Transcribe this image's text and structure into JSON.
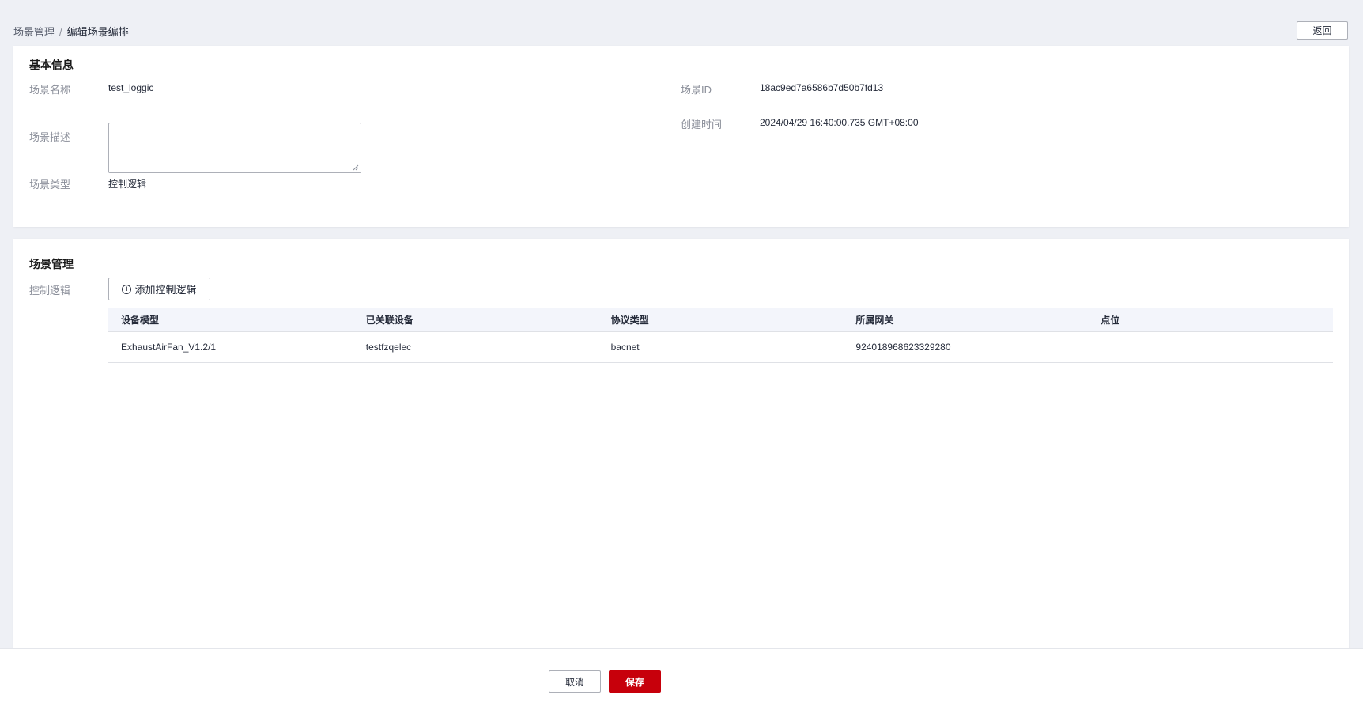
{
  "breadcrumb": {
    "parent": "场景管理",
    "separator": "/",
    "current": "编辑场景编排"
  },
  "back_button": "返回",
  "basic_info": {
    "title": "基本信息",
    "scene_name_label": "场景名称",
    "scene_name_value": "test_loggic",
    "scene_desc_label": "场景描述",
    "scene_desc_value": "",
    "scene_type_label": "场景类型",
    "scene_type_value": "控制逻辑",
    "scene_id_label": "场景ID",
    "scene_id_value": "18ac9ed7a6586b7d50b7fd13",
    "created_label": "创建时间",
    "created_value": "2024/04/29 16:40:00.735 GMT+08:00"
  },
  "scene_mgmt": {
    "title": "场景管理",
    "control_logic_label": "控制逻辑",
    "add_button": "添加控制逻辑",
    "add_icon": "plus-circle-icon",
    "columns": [
      "设备模型",
      "已关联设备",
      "协议类型",
      "所属网关",
      "点位"
    ],
    "rows": [
      [
        "ExhaustAirFan_V1.2/1",
        "testfzqelec",
        "bacnet",
        "924018968623329280",
        ""
      ]
    ]
  },
  "footer": {
    "cancel": "取消",
    "save": "保存"
  },
  "colors": {
    "primary": "#c7000b",
    "background": "#eef0f5",
    "table_header": "#f3f5fb"
  }
}
